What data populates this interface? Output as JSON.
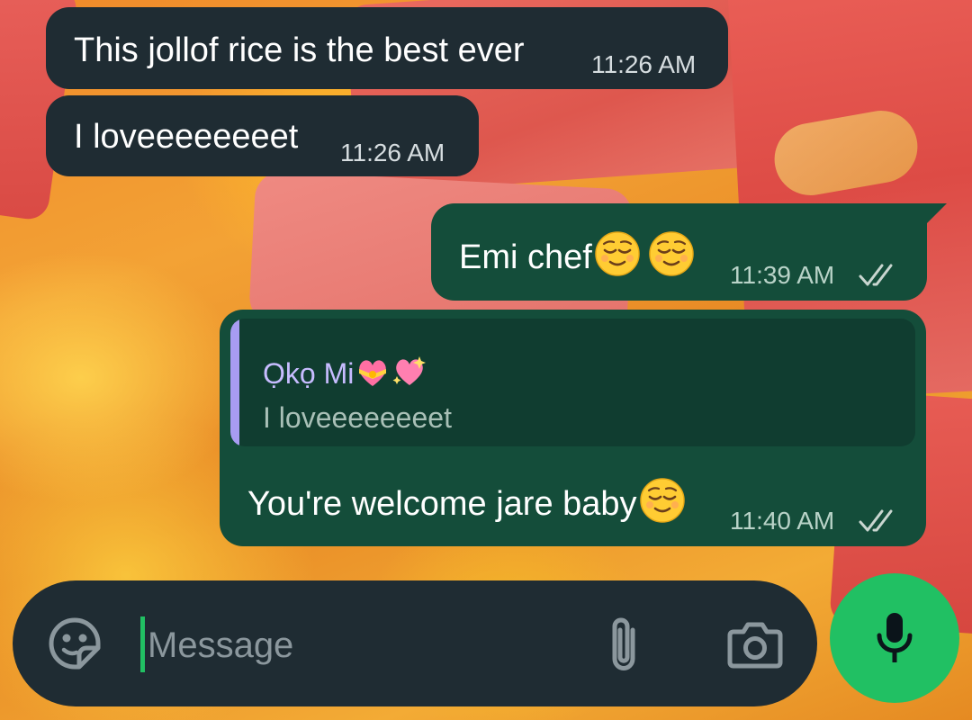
{
  "chat": {
    "messages": [
      {
        "direction": "incoming",
        "text": "This jollof rice is the best ever",
        "time": "11:26 AM"
      },
      {
        "direction": "incoming",
        "text": "I loveeeeeeeet",
        "time": "11:26 AM"
      },
      {
        "direction": "outgoing",
        "text": "Emi chef",
        "emojis": [
          "relieved-face-emoji",
          "relieved-face-emoji"
        ],
        "time": "11:39 AM",
        "status": "read-double-check"
      },
      {
        "direction": "outgoing",
        "reply_to": {
          "author": "Ọkọ Mi",
          "author_emojis": [
            "heart-with-ribbon-emoji",
            "sparkling-heart-emoji"
          ],
          "text": "I loveeeeeeeet"
        },
        "text": "You're welcome jare baby",
        "emojis": [
          "relieved-face-emoji"
        ],
        "time": "11:40 AM",
        "status": "read-double-check"
      }
    ]
  },
  "composer": {
    "placeholder": "Message",
    "value": "",
    "left_icon": "sticker-icon",
    "attach_icon": "paperclip-icon",
    "camera_icon": "camera-icon",
    "send_button_icon": "microphone-icon"
  },
  "colors": {
    "incoming_bubble": "#1f2c33",
    "outgoing_bubble": "#144d3a",
    "quote_bar": "#a89cf2",
    "quote_author": "#c7bcff",
    "accent_green": "#21c063"
  }
}
